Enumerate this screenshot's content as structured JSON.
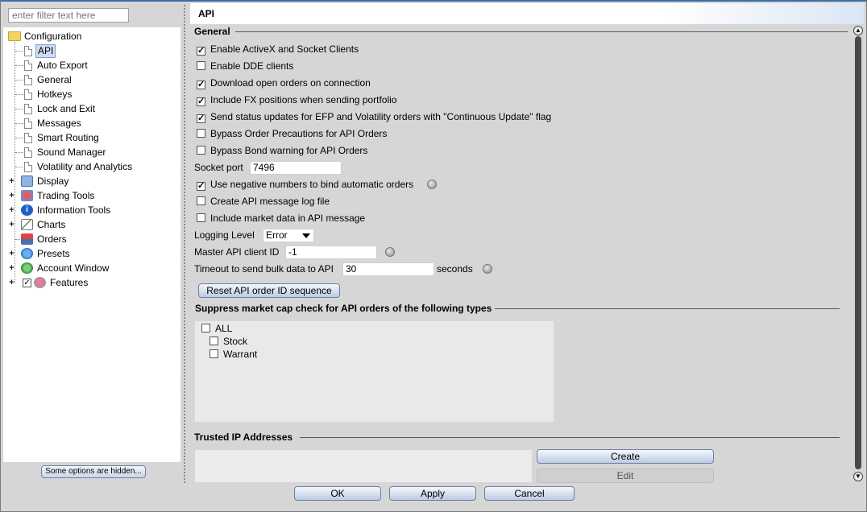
{
  "filter": {
    "placeholder": "enter filter text here"
  },
  "tree": {
    "configuration": "Configuration",
    "children": [
      "API",
      "Auto Export",
      "General",
      "Hotkeys",
      "Lock and Exit",
      "Messages",
      "Smart Routing",
      "Sound Manager",
      "Volatility and Analytics"
    ],
    "groups": [
      "Display",
      "Trading Tools",
      "Information Tools",
      "Charts",
      "Orders",
      "Presets",
      "Account Window",
      "Features"
    ]
  },
  "hidden_button": "Some options are hidden...",
  "header": {
    "title": "API"
  },
  "general": {
    "title": "General",
    "options": [
      {
        "label": "Enable ActiveX and Socket Clients",
        "checked": true
      },
      {
        "label": "Enable DDE clients",
        "checked": false
      },
      {
        "label": "Download open orders on connection",
        "checked": true
      },
      {
        "label": "Include FX positions when sending portfolio",
        "checked": true
      },
      {
        "label": "Send status updates for EFP and Volatility orders with \"Continuous Update\" flag",
        "checked": true
      },
      {
        "label": "Bypass Order Precautions for API Orders",
        "checked": false
      },
      {
        "label": "Bypass Bond warning for API Orders",
        "checked": false
      }
    ],
    "socket_port_label": "Socket port",
    "socket_port_value": "7496",
    "options2": [
      {
        "label": "Use negative numbers to bind automatic orders",
        "checked": true
      },
      {
        "label": "Create API message log file",
        "checked": false
      },
      {
        "label": "Include market data in API message",
        "checked": false
      }
    ],
    "logging_label": "Logging Level",
    "logging_value": "Error",
    "master_label": "Master API client ID",
    "master_value": "-1",
    "timeout_label": "Timeout to send bulk data to API",
    "timeout_value": "30",
    "timeout_unit": "seconds",
    "reset_button": "Reset API order ID sequence"
  },
  "suppress": {
    "title": "Suppress market cap check for API orders of the following types",
    "items": [
      "ALL",
      "Stock",
      "Warrant"
    ]
  },
  "trusted": {
    "title": "Trusted IP Addresses",
    "create": "Create",
    "edit": "Edit"
  },
  "footer": {
    "ok": "OK",
    "apply": "Apply",
    "cancel": "Cancel"
  },
  "colors": {
    "accent": "#3a6ea5",
    "selection": "#cfdcf2"
  }
}
